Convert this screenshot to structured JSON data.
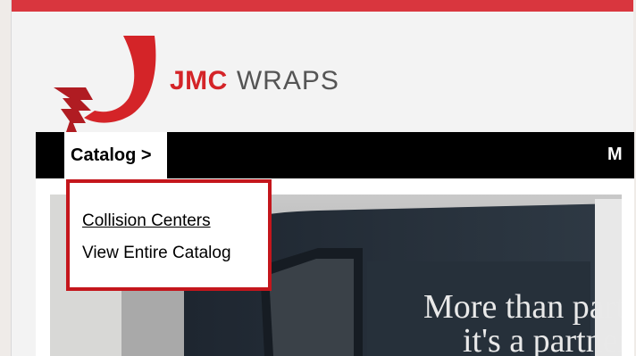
{
  "brand": {
    "name_bold": "JMC",
    "name_light": "WRAPS"
  },
  "nav": {
    "catalog_label": "Catalog >",
    "next_label": "M"
  },
  "dropdown": {
    "items": [
      {
        "label": "Collision Centers",
        "underlined": true
      },
      {
        "label": "View Entire Catalog",
        "underlined": false
      }
    ]
  },
  "hero": {
    "van_text_line1": "More than parts",
    "van_text_line2": "it's a partners"
  },
  "colors": {
    "brand_red": "#d42428",
    "dropdown_border": "#c4161c",
    "nav_bg": "#000000"
  }
}
